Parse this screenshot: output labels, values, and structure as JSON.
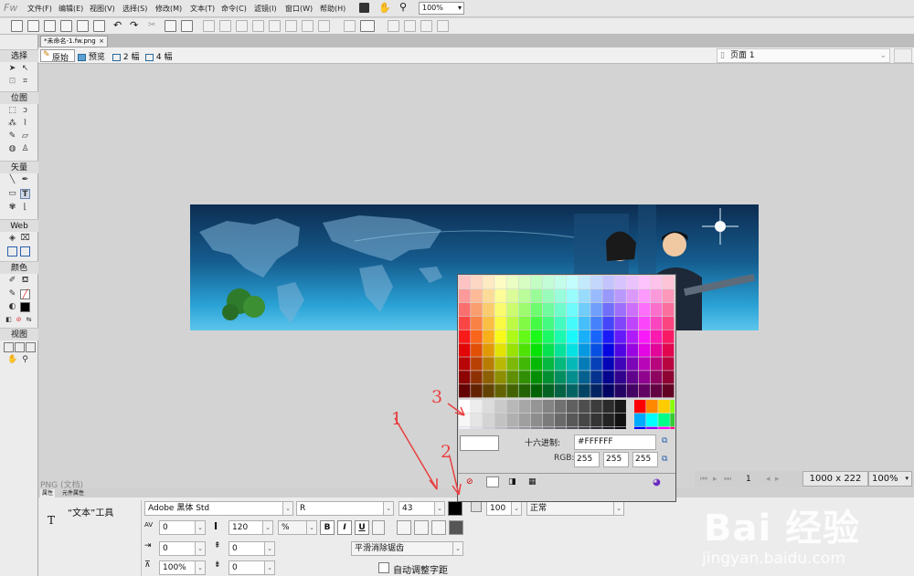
{
  "app": {
    "logo": "Fw"
  },
  "menu": [
    "文件(F)",
    "编辑(E)",
    "视图(V)",
    "选择(S)",
    "修改(M)",
    "文本(T)",
    "命令(C)",
    "滤镜(I)",
    "窗口(W)",
    "帮助(H)"
  ],
  "zoom_top": "100%",
  "doc_tab": "*未命名-1.fw.png",
  "view_buttons": [
    "原始",
    "预览",
    "2 幅",
    "4 幅"
  ],
  "page_select": "页面 1",
  "tools": {
    "sections": [
      "选择",
      "位图",
      "矢量",
      "Web",
      "颜色",
      "视图"
    ]
  },
  "canvas_label": "PNG (文档)",
  "status": {
    "page": "1",
    "size": "1000 x 222",
    "zoom": "100%"
  },
  "props": {
    "tabs": [
      "属性",
      "元件属性"
    ],
    "tool_name": "“文本”工具",
    "tool_icon": "T",
    "font_family": "Adobe 黑体 Std",
    "font_style": "R",
    "font_size": "43",
    "kerning": "0",
    "leading": "120",
    "leading_unit": "%",
    "bold": "B",
    "italic": "I",
    "underline": "U",
    "indent": "0",
    "space_before": "0",
    "horiz_scale": "100%",
    "space_after": "0",
    "antialias": "平滑消除锯齿",
    "auto_kern": "自动调整字距",
    "opacity": "100",
    "blend": "正常"
  },
  "picker": {
    "hex_label": "十六进制:",
    "hex_value": "#FFFFFF",
    "rgb_label": "RGB:",
    "r": "255",
    "g": "255",
    "b": "255"
  },
  "annotations": [
    "1",
    "2",
    "3"
  ],
  "watermark": {
    "main": "Bai 经验",
    "sub": "jingyan.baidu.com"
  }
}
